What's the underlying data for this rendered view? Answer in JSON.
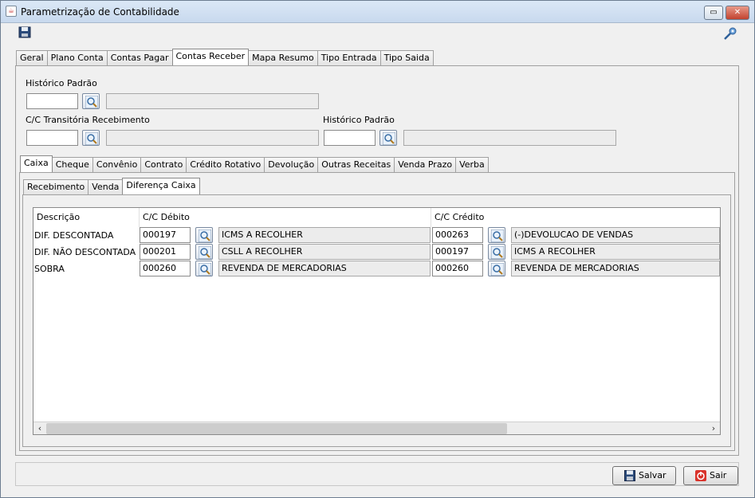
{
  "window": {
    "title": "Parametrização de Contabilidade"
  },
  "main_tabs": [
    "Geral",
    "Plano Conta",
    "Contas Pagar",
    "Contas Receber",
    "Mapa Resumo",
    "Tipo Entrada",
    "Tipo Saida"
  ],
  "main_tab_active": "Contas Receber",
  "fields": {
    "historico_padrao_1": {
      "label": "Histórico Padrão",
      "code": "",
      "desc": ""
    },
    "cc_transitoria": {
      "label": "C/C Transitória Recebimento",
      "code": "",
      "desc": ""
    },
    "historico_padrao_2": {
      "label": "Histórico Padrão",
      "code": "",
      "desc": ""
    }
  },
  "sub_tabs": [
    "Caixa",
    "Cheque",
    "Convênio",
    "Contrato",
    "Crédito Rotativo",
    "Devolução",
    "Outras Receitas",
    "Venda Prazo",
    "Verba"
  ],
  "sub_tab_active": "Caixa",
  "inner_tabs": [
    "Recebimento",
    "Venda",
    "Diferença Caixa"
  ],
  "inner_tab_active": "Diferença Caixa",
  "grid": {
    "headers": {
      "descricao": "Descrição",
      "debito": "C/C Débito",
      "credito": "C/C Crédito"
    },
    "rows": [
      {
        "descricao": "DIF. DESCONTADA",
        "debito_code": "000197",
        "debito_desc": "ICMS A RECOLHER",
        "credito_code": "000263",
        "credito_desc": "(-)DEVOLUCAO DE VENDAS"
      },
      {
        "descricao": "DIF. NÃO DESCONTADA",
        "debito_code": "000201",
        "debito_desc": "CSLL A RECOLHER",
        "credito_code": "000197",
        "credito_desc": "ICMS A RECOLHER"
      },
      {
        "descricao": "SOBRA",
        "debito_code": "000260",
        "debito_desc": "REVENDA DE MERCADORIAS",
        "credito_code": "000260",
        "credito_desc": "REVENDA DE MERCADORIAS"
      }
    ]
  },
  "buttons": {
    "save": "Salvar",
    "exit": "Sair"
  },
  "icons": {
    "save": "floppy-icon",
    "key": "key-icon",
    "lookup": "magnifier-icon",
    "exit": "power-icon"
  }
}
